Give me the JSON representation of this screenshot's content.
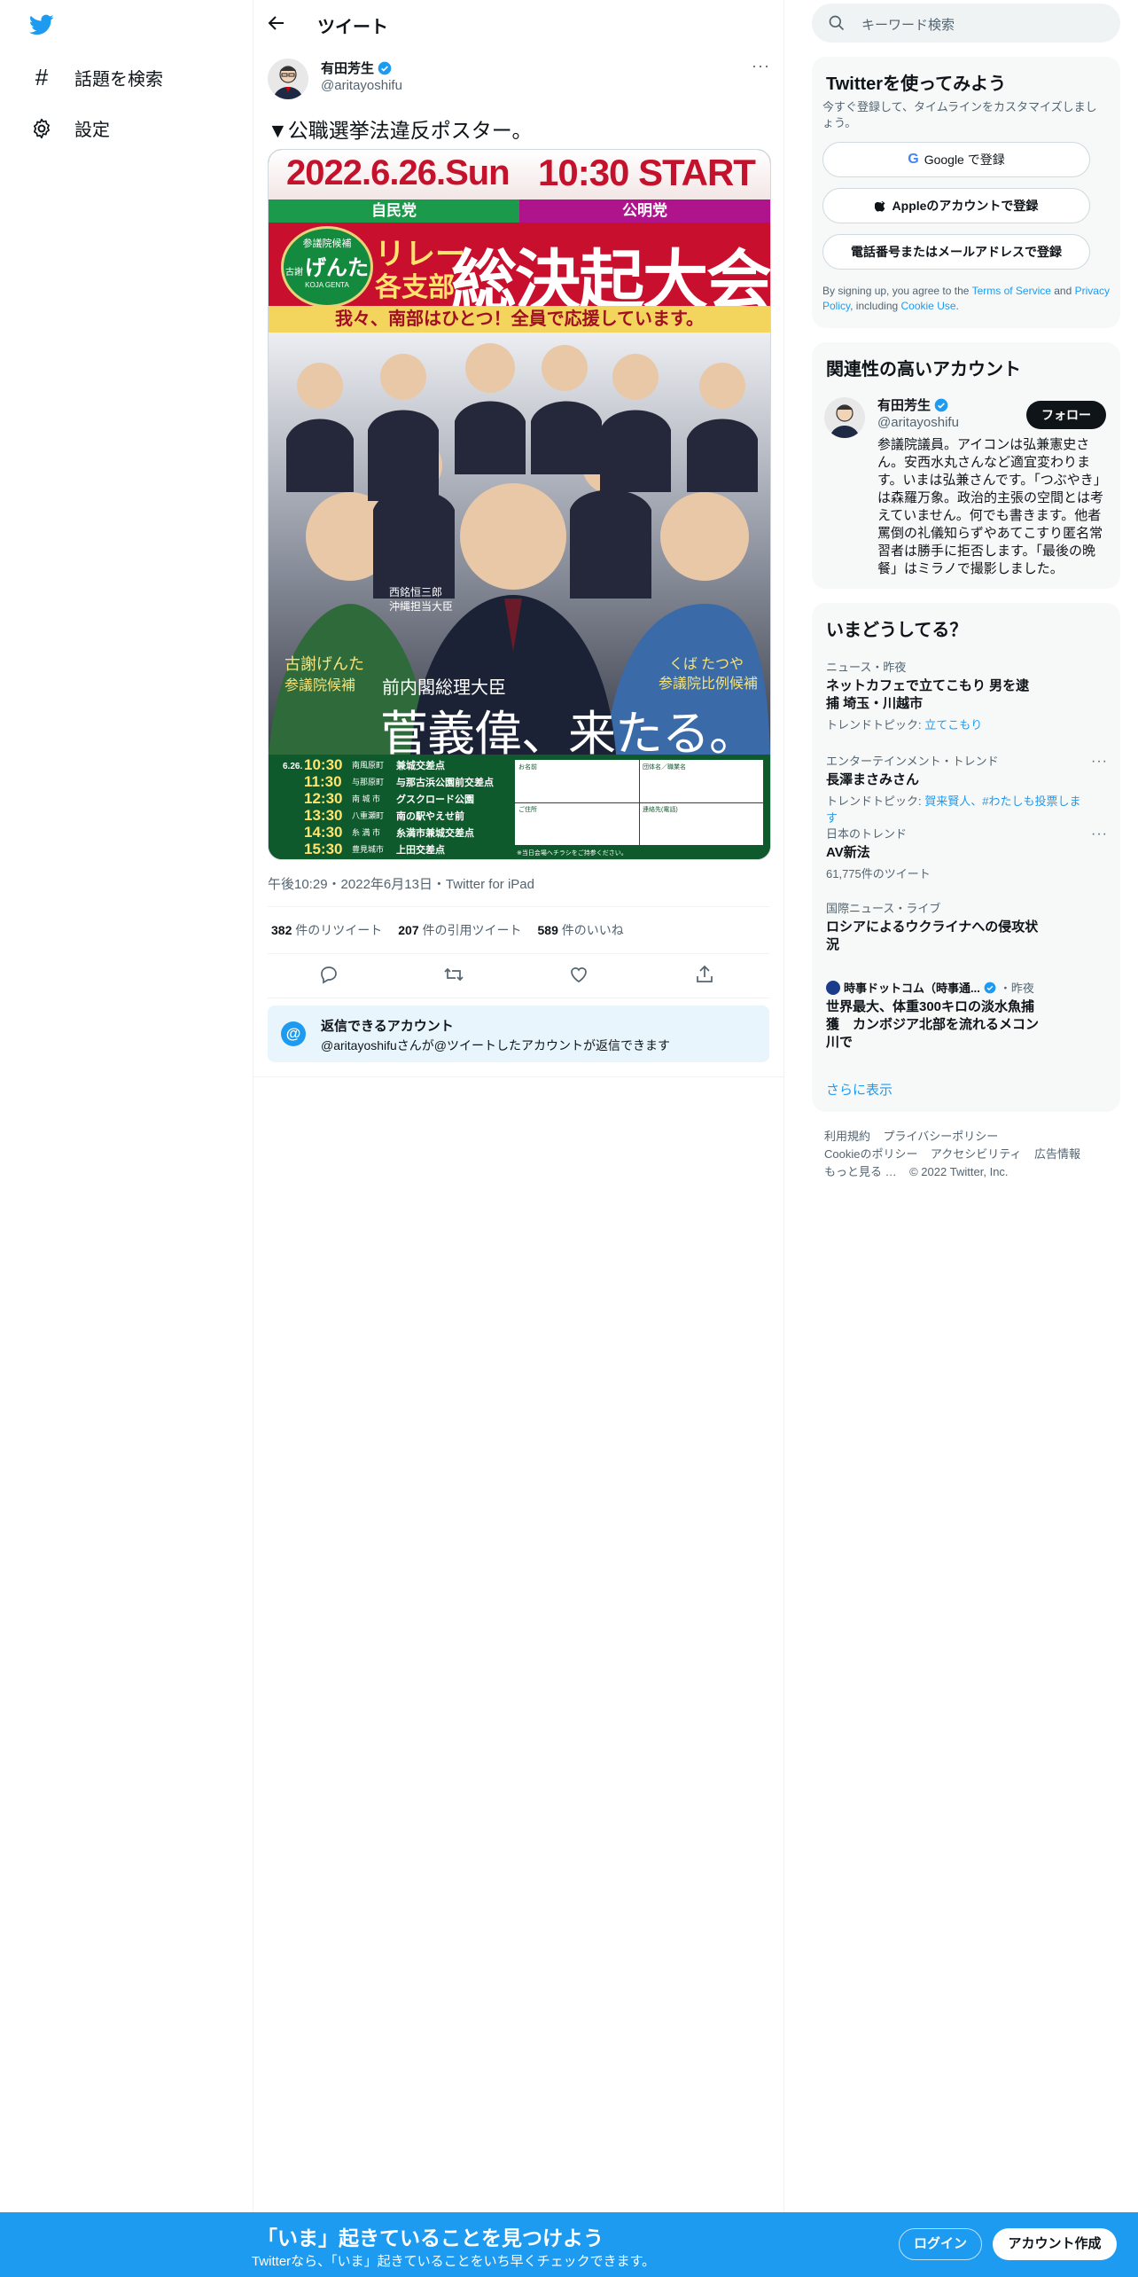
{
  "nav": {
    "explore": "話題を検索",
    "settings": "設定"
  },
  "header": {
    "title": "ツイート"
  },
  "tweet": {
    "author_name": "有田芳生",
    "author_handle": "@aritayoshifu",
    "text": "▼公職選挙法違反ポスター。",
    "timestamp": "午後10:29・2022年6月13日・Twitter for iPad",
    "retweets_count": "382",
    "retweets_label": "件のリツイート",
    "quotes_count": "207",
    "quotes_label": "件の引用ツイート",
    "likes_count": "589",
    "likes_label": "件のいいね",
    "reply_box_title": "返信できるアカウント",
    "reply_box_text": "@aritayoshifuさんが@ツイートしたアカウントが返信できます"
  },
  "poster": {
    "date": "2022.6.26.Sun",
    "time": "10:30 START",
    "party_left": "自民党",
    "party_right": "公明党",
    "badge_top": "参議院候補",
    "badge_name": "げんた",
    "badge_prefix": "古謝",
    "badge_roman": "KOJA GENTA",
    "relay": "リレー",
    "branch": "各支部",
    "headline": "総決起大会",
    "slogan": "我々、南部はひとつ！全員で応援しています。",
    "left_label_1": "古謝げんた",
    "left_label_2": "参議院候補",
    "right_label_1": "くば たつや",
    "right_label_2": "参議院比例候補",
    "center_small": "前内閣総理大臣",
    "center_big": "菅義偉、来たる。",
    "person_label_1": "西銘恒三郎",
    "person_label_2": "沖縄担当大臣",
    "schedule_date": "6.26.",
    "schedule": [
      {
        "time": "10:30",
        "town": "南風原町",
        "place": "兼城交差点"
      },
      {
        "time": "11:30",
        "town": "与那原町",
        "place": "与那古浜公園前交差点"
      },
      {
        "time": "12:30",
        "town": "南 城 市",
        "place": "グスクロード公園"
      },
      {
        "time": "13:30",
        "town": "八重瀬町",
        "place": "南の駅やえせ前"
      },
      {
        "time": "14:30",
        "town": "糸 満 市",
        "place": "糸満市兼城交差点"
      },
      {
        "time": "15:30",
        "town": "豊見城市",
        "place": "上田交差点"
      }
    ],
    "form_name": "お名前",
    "form_org": "団体名／職業名",
    "form_address": "ご住所",
    "form_phone": "連絡先(電話)",
    "form_note": "※当日会場へチラシをご持参ください。"
  },
  "right": {
    "search_placeholder": "キーワード検索",
    "signup_title": "Twitterを使ってみよう",
    "signup_sub": "今すぐ登録して、タイムラインをカスタマイズしましょう。",
    "google_btn": "Google で登録",
    "apple_btn": "Appleのアカウントで登録",
    "phone_btn": "電話番号またはメールアドレスで登録",
    "tos_1": "By signing up, you agree to the ",
    "tos_link_1": "Terms of Service",
    "tos_2": " and ",
    "tos_link_2": "Privacy Policy",
    "tos_3": ", including ",
    "tos_link_3": "Cookie Use",
    "tos_4": ".",
    "related_title": "関連性の高いアカウント",
    "related_name": "有田芳生",
    "related_handle": "@aritayoshifu",
    "follow_btn": "フォロー",
    "related_bio": "参議院議員。アイコンは弘兼憲史さん。安西水丸さんなど適宜変わります。いまは弘兼さんです。「つぶやき」は森羅万象。政治的主張の空間とは考えていません。何でも書きます。他者罵倒の礼儀知らずやあてこすり匿名常習者は勝手に拒否します。「最後の晩餐」はミラノで撮影しました。",
    "trends_title": "いまどうしてる？",
    "trends": [
      {
        "ctx": "ニュース・昨夜",
        "title": "ネットカフェで立てこもり 男を逮捕 埼玉・川越市",
        "sub_prefix": "トレンドトピック: ",
        "sub_link": "立てこもり"
      },
      {
        "ctx": "エンターテインメント・トレンド",
        "title": "長澤まさみさん",
        "sub_prefix": "トレンドトピック: ",
        "sub_link": "賀来賢人、#わたしも投票します"
      },
      {
        "ctx": "日本のトレンド",
        "title": "AV新法",
        "sub_plain": "61,775件のツイート"
      },
      {
        "ctx": "国際ニュース・ライブ",
        "title": "ロシアによるウクライナへの侵攻状況"
      },
      {
        "source": "時事ドットコム（時事通...",
        "source_time": "・昨夜",
        "title": "世界最大、体重300キロの淡水魚捕獲　カンボジア北部を流れるメコン川で"
      }
    ],
    "show_more": "さらに表示",
    "footer_1": "利用規約",
    "footer_2": "プライバシーポリシー",
    "footer_3": "Cookieのポリシー",
    "footer_4": "アクセシビリティ",
    "footer_5": "広告情報",
    "footer_6": "もっと見る …",
    "footer_7": "© 2022 Twitter, Inc."
  },
  "bottom": {
    "title": "「いま」起きていることを見つけよう",
    "sub": "Twitterなら、「いま」起きていることをいち早くチェックできます。",
    "login": "ログイン",
    "signup": "アカウント作成"
  },
  "colors": {
    "accent": "#1d9bf0",
    "text": "#0f1419",
    "muted": "#536471"
  }
}
